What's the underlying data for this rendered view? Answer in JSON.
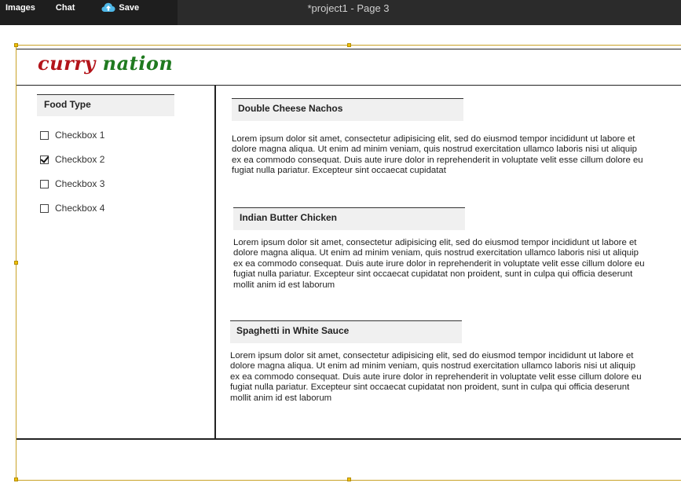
{
  "toolbar": {
    "images_label": "Images",
    "chat_label": "Chat",
    "save_label": "Save",
    "page_title": "*project1 - Page 3"
  },
  "header": {
    "logo_word1": "curry",
    "logo_word2": "nation",
    "logo_colors": {
      "word1": "#b3141a",
      "word2": "#1f7a1f"
    }
  },
  "sidebar": {
    "heading": "Food Type",
    "checkboxes": [
      {
        "label": "Checkbox 1",
        "checked": false
      },
      {
        "label": "Checkbox 2",
        "checked": true
      },
      {
        "label": "Checkbox 3",
        "checked": false
      },
      {
        "label": "Checkbox 4",
        "checked": false
      }
    ]
  },
  "articles": [
    {
      "title": "Double Cheese Nachos",
      "body": "Lorem ipsum dolor sit amet, consectetur adipisicing elit, sed do eiusmod tempor incididunt ut labore et dolore magna aliqua. Ut enim ad minim veniam, quis nostrud exercitation ullamco laboris nisi ut aliquip ex ea commodo consequat. Duis aute irure dolor in reprehenderit in voluptate velit esse cillum dolore eu fugiat nulla pariatur. Excepteur sint occaecat cupidatat"
    },
    {
      "title": "Indian Butter Chicken",
      "body": "Lorem ipsum dolor sit amet, consectetur adipisicing elit, sed do eiusmod tempor incididunt ut labore et dolore magna aliqua. Ut enim ad minim veniam, quis nostrud exercitation ullamco laboris nisi ut aliquip ex ea commodo consequat. Duis aute irure dolor in reprehenderit in voluptate velit esse cillum dolore eu fugiat nulla pariatur. Excepteur sint occaecat cupidatat non proident, sunt in culpa qui officia deserunt mollit anim id est laborum"
    },
    {
      "title": "Spaghetti in White Sauce",
      "body": "Lorem ipsum dolor sit amet, consectetur adipisicing elit, sed do eiusmod tempor incididunt ut labore et dolore magna aliqua. Ut enim ad minim veniam, quis nostrud exercitation ullamco laboris nisi ut aliquip ex ea commodo consequat. Duis aute irure dolor in reprehenderit in voluptate velit esse cillum dolore eu fugiat nulla pariatur. Excepteur sint occaecat cupidatat non proident, sunt in culpa qui officia deserunt mollit anim id est laborum"
    }
  ],
  "colors": {
    "toolbar_bg": "#2b2b2b",
    "selection": "#c9a227"
  }
}
